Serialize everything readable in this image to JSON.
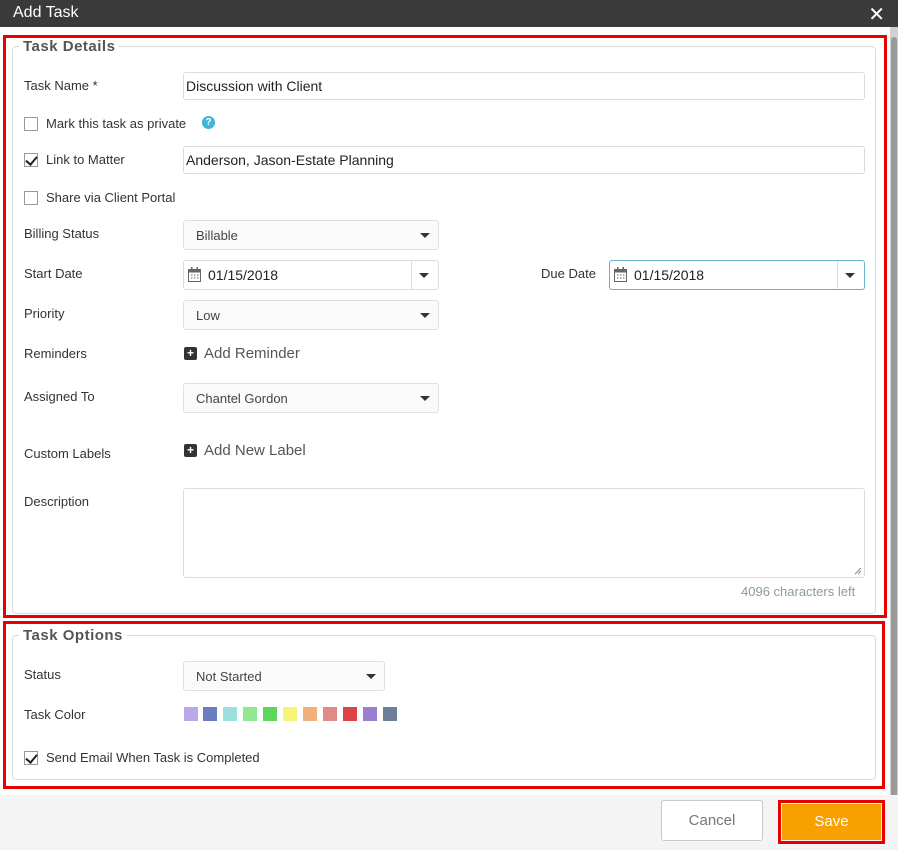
{
  "dialog": {
    "title": "Add Task",
    "close_glyph": "✕"
  },
  "task_details": {
    "legend": "Task Details",
    "task_name_label": "Task Name *",
    "task_name_value": "Discussion with Client",
    "private_label": "Mark this task as private",
    "private_checked": false,
    "link_label": "Link to Matter",
    "link_checked": true,
    "link_value": "Anderson, Jason-Estate Planning",
    "share_label": "Share via Client Portal",
    "share_checked": false,
    "billing_label": "Billing Status",
    "billing_value": "Billable",
    "start_label": "Start Date",
    "start_value": "01/15/2018",
    "due_label": "Due Date",
    "due_value": "01/15/2018",
    "priority_label": "Priority",
    "priority_value": "Low",
    "reminders_label": "Reminders",
    "add_reminder": "Add Reminder",
    "assigned_label": "Assigned To",
    "assigned_value": "Chantel Gordon",
    "labels_label": "Custom Labels",
    "add_label": "Add New Label",
    "description_label": "Description",
    "description_value": "",
    "chars_left": "4096 characters left"
  },
  "task_options": {
    "legend": "Task Options",
    "status_label": "Status",
    "status_value": "Not Started",
    "color_label": "Task Color",
    "colors": [
      "#b9a9e6",
      "#6a7dc0",
      "#9ee0dd",
      "#90e890",
      "#5dd65d",
      "#f5f57a",
      "#f2b07a",
      "#e08a8a",
      "#dd4444",
      "#9b7fcf",
      "#6f7f99"
    ],
    "email_label": "Send Email When Task is Completed",
    "email_checked": true
  },
  "footer": {
    "cancel_label": "Cancel",
    "save_label": "Save"
  },
  "icons": {
    "plus": "+",
    "help": "?"
  }
}
